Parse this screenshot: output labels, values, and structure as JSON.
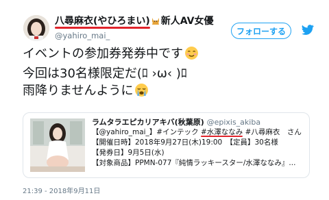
{
  "user": {
    "display_name": "八尋麻衣(やひろまい)",
    "name_suffix": "新人AV女優",
    "handle": "@yahiro_mai_"
  },
  "follow_label": "フォローする",
  "tweet_lines": [
    "イベントの参加券発券中です",
    "今回は30名様限定だ(ﾛ ›ω‹ )ﾛ",
    "雨降りませんように"
  ],
  "card": {
    "title": "ラムタラエピカリアキバ(秋葉原)",
    "title_handle": "@epixis_akiba",
    "line1_a": "【@yahiro_mai_】#インテック",
    "line1_b": "#水澤ななみ",
    "line1_c": "#八尋麻衣　さん",
    "line2": "【開催日時】2018年9月27日(木)19:00　【定員】30名様",
    "line3": "【発券日】9月5日(水)",
    "line4": "【対象商品】PPMN-077『純情ラッキースター/水澤ななみ』..."
  },
  "timestamp": "21:39 - 2018年9月11日",
  "colors": {
    "accent": "#1da1f2",
    "underline": "#e0242b",
    "muted": "#657786"
  }
}
